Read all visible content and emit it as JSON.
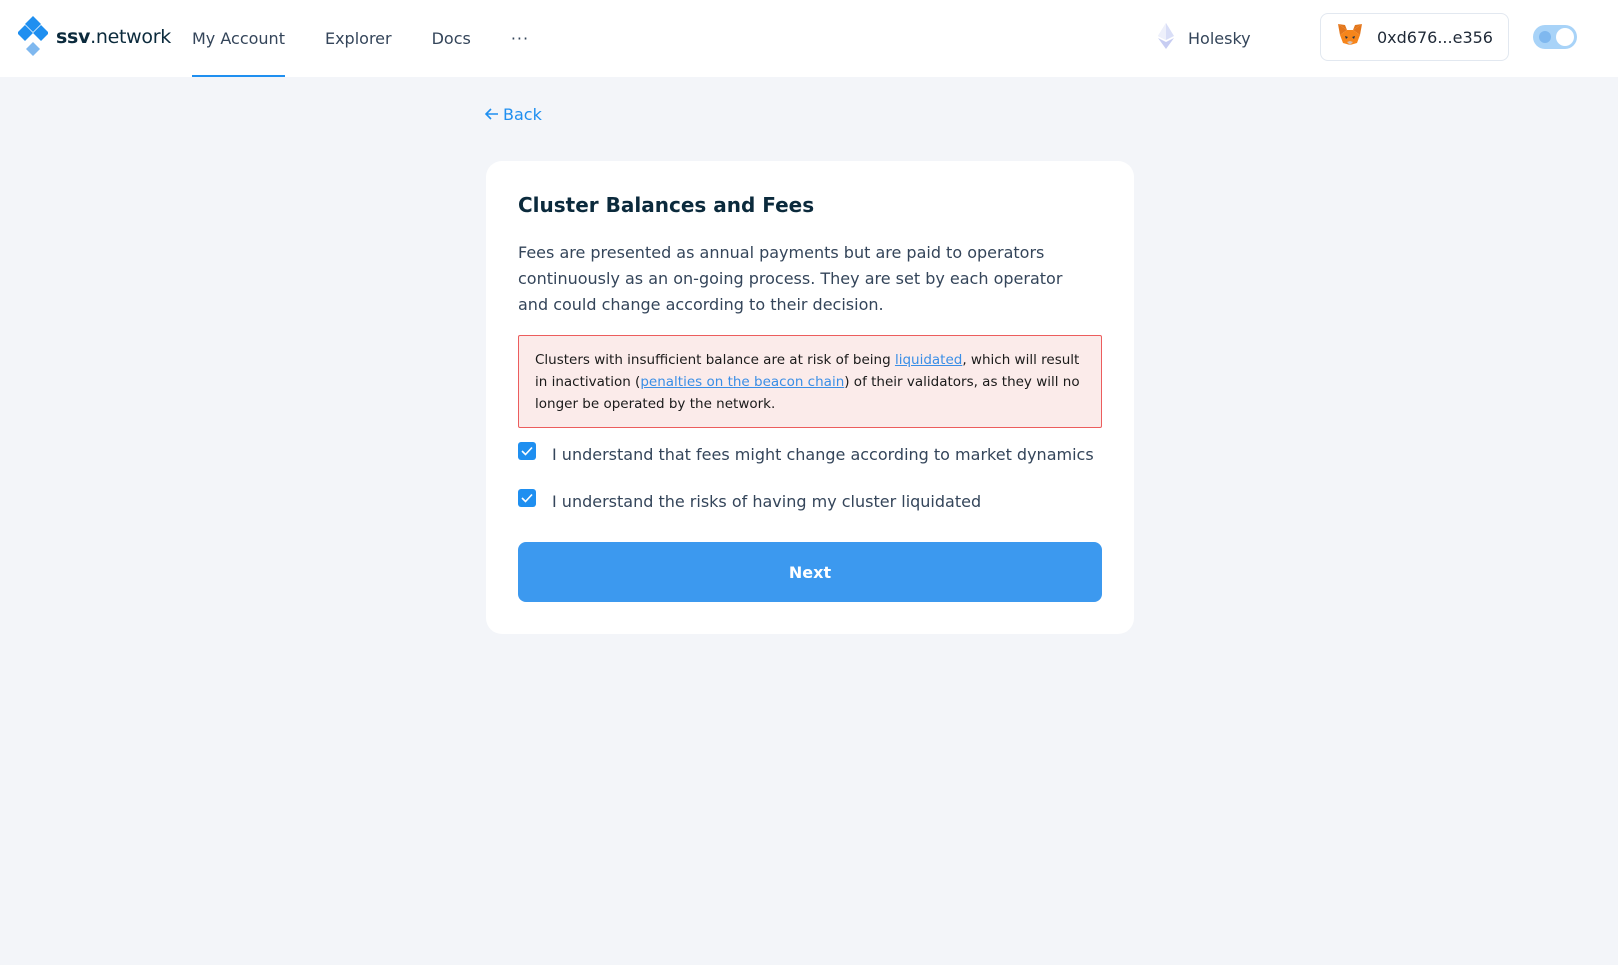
{
  "header": {
    "logo": {
      "bold": "ssv",
      "rest": ".network"
    },
    "nav": [
      {
        "label": "My Account",
        "active": true
      },
      {
        "label": "Explorer",
        "active": false
      },
      {
        "label": "Docs",
        "active": false
      }
    ],
    "more_label": "···",
    "network": {
      "label": "Holesky",
      "icon": "ethereum-icon"
    },
    "wallet": {
      "address": "0xd676...e356",
      "icon": "metamask-fox-icon"
    },
    "theme_toggle": {
      "on": true
    }
  },
  "back": {
    "label": "Back",
    "icon": "arrow-left-icon"
  },
  "card": {
    "title": "Cluster Balances and Fees",
    "description": "Fees are presented as annual payments but are paid to operators continuously as an on-going process. They are set by each operator and could change according to their decision.",
    "warning": {
      "part1": "Clusters with insufficient balance are at risk of being ",
      "link1": "liquidated",
      "part2": ", which will result in inactivation (",
      "link2": "penalties on the beacon chain",
      "part3": ") of their validators, as they will no longer be operated by the network."
    },
    "checkboxes": [
      {
        "label": "I understand that fees might change according to market dynamics",
        "checked": true
      },
      {
        "label": "I understand the risks of having my cluster liquidated",
        "checked": true
      }
    ],
    "next_label": "Next"
  },
  "colors": {
    "accent": "#1f8ff0",
    "button": "#3c99ef",
    "warning_bg": "#fbebea",
    "warning_border": "#ec5d5d",
    "page_bg": "#f3f5f9"
  }
}
